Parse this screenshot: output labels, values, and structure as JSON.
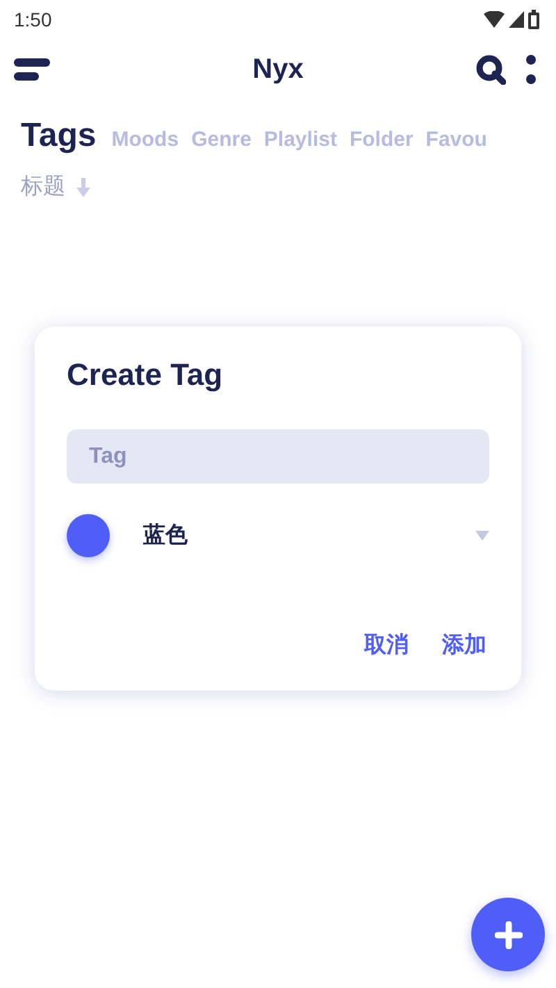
{
  "status_bar": {
    "time": "1:50"
  },
  "app_bar": {
    "title": "Nyx"
  },
  "tabs": [
    {
      "label": "Tags",
      "selected": true
    },
    {
      "label": "Moods",
      "selected": false
    },
    {
      "label": "Genre",
      "selected": false
    },
    {
      "label": "Playlist",
      "selected": false
    },
    {
      "label": "Folder",
      "selected": false
    },
    {
      "label": "Favou",
      "selected": false
    }
  ],
  "sort": {
    "label": "标题"
  },
  "dialog": {
    "title": "Create Tag",
    "field": {
      "placeholder": "Tag"
    },
    "color_picker": {
      "label": "蓝色",
      "color": "#4f5ef7"
    },
    "buttons": [
      "取消",
      "添加"
    ]
  }
}
